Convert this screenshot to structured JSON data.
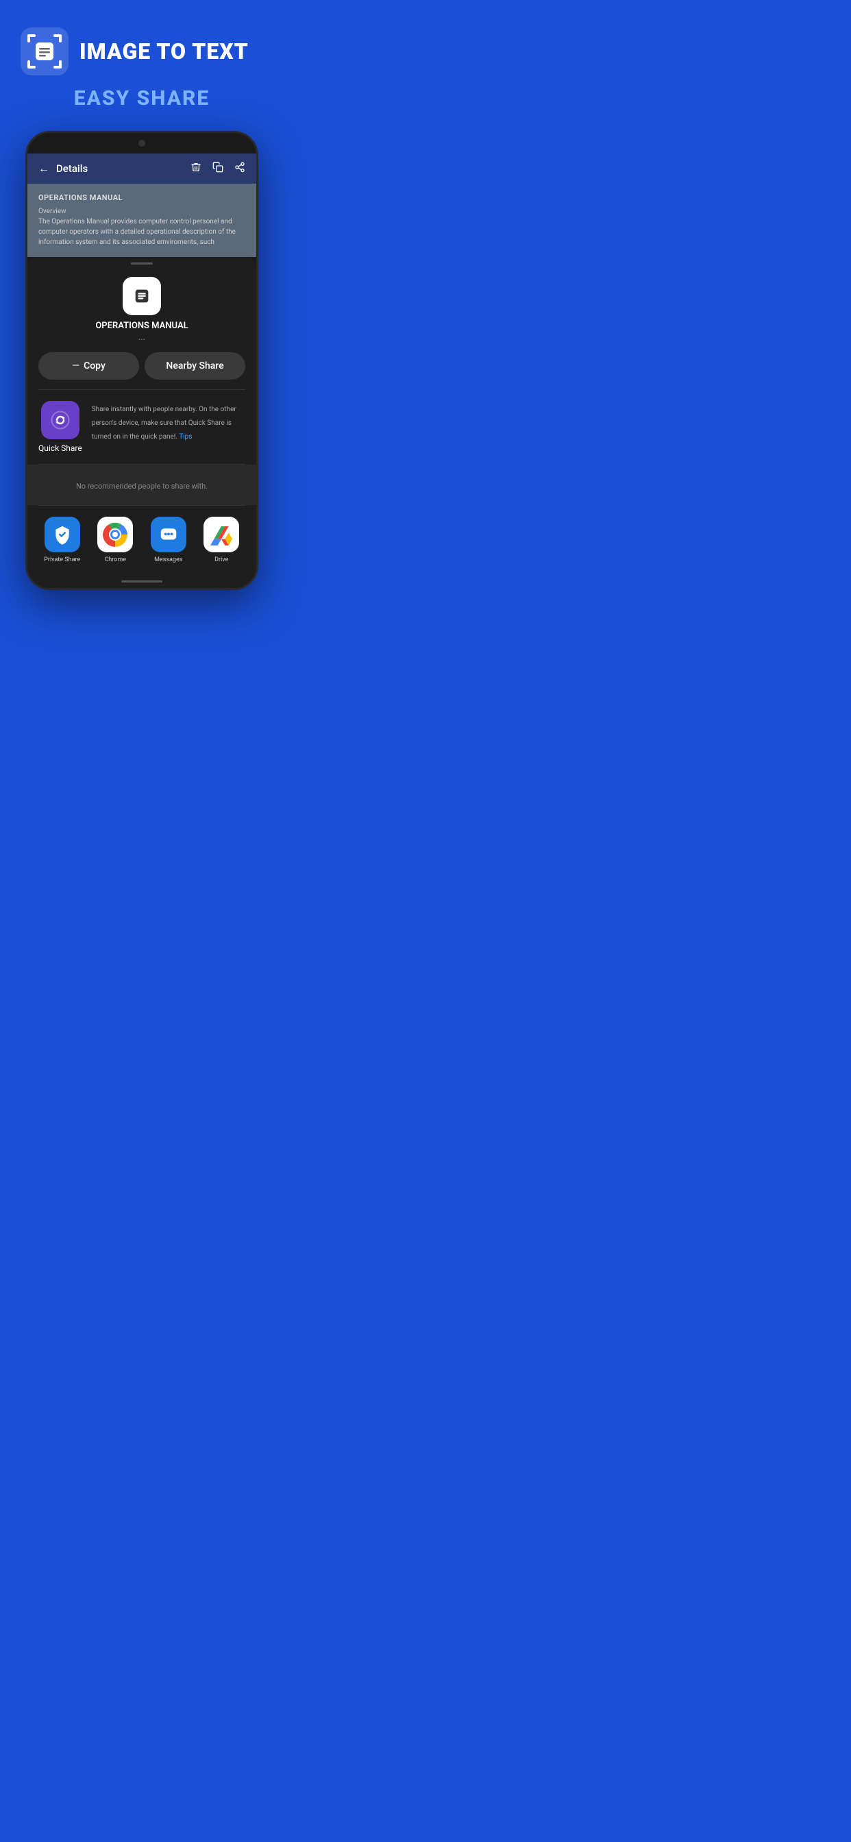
{
  "header": {
    "app_title": "IMAGE TO TEXT",
    "subtitle": "EASY SHARE"
  },
  "phone": {
    "nav": {
      "back_label": "←",
      "title": "Details",
      "icons": [
        "🗑",
        "⧉",
        "⎋"
      ]
    },
    "content": {
      "title": "OPERATIONS MANUAL",
      "body": "Overview\nThe Operations Manual provides computer control personel and computer operators with a detailed operational description of the information system and its associated emviroments, such"
    },
    "share_sheet": {
      "app_name": "OPERATIONS MANUAL",
      "app_dots": "...",
      "buttons": {
        "copy": "Copy",
        "nearby_share": "Nearby Share"
      },
      "quick_share": {
        "label": "Quick Share",
        "description": "Share instantly with people nearby. On the other person's device, make sure that Quick Share is turned on in the quick panel.",
        "tips_link": "Tips"
      },
      "no_recommended": "No recommended people to share with.",
      "apps": [
        {
          "name": "Private Share",
          "color": "#1e7be0"
        },
        {
          "name": "Chrome",
          "color": "#ffffff"
        },
        {
          "name": "Messages",
          "color": "#1e7be0"
        },
        {
          "name": "Drive",
          "color": "#ffffff"
        }
      ]
    }
  }
}
